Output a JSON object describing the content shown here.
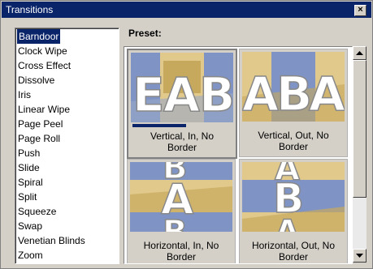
{
  "window": {
    "title": "Transitions",
    "close_glyph": "×"
  },
  "list": {
    "selected": "Barndoor",
    "items": [
      "Barndoor",
      "Clock Wipe",
      "Cross Effect",
      "Dissolve",
      "Iris",
      "Linear Wipe",
      "Page Peel",
      "Page Roll",
      "Push",
      "Slide",
      "Spiral",
      "Split",
      "Squeeze",
      "Swap",
      "Venetian Blinds",
      "Zoom"
    ]
  },
  "preset": {
    "label": "Preset:",
    "tiles": [
      {
        "line1": "Vertical, In, No",
        "line2": "Border",
        "thumb_letters": [
          "E",
          "A",
          "B"
        ],
        "selected": true
      },
      {
        "line1": "Vertical, Out, No",
        "line2": "Border",
        "thumb_letters": [
          "A",
          "B",
          "A"
        ],
        "selected": false
      },
      {
        "line1": "Horizontal, In, No",
        "line2": "Border",
        "thumb_letters": [
          "B",
          "A",
          "B"
        ],
        "selected": false
      },
      {
        "line1": "Horizontal, Out, No",
        "line2": "Border",
        "thumb_letters": [
          "A",
          "B",
          "A"
        ],
        "selected": false
      }
    ]
  },
  "colors": {
    "selection": "#0a246a",
    "face": "#d4d0c8"
  }
}
